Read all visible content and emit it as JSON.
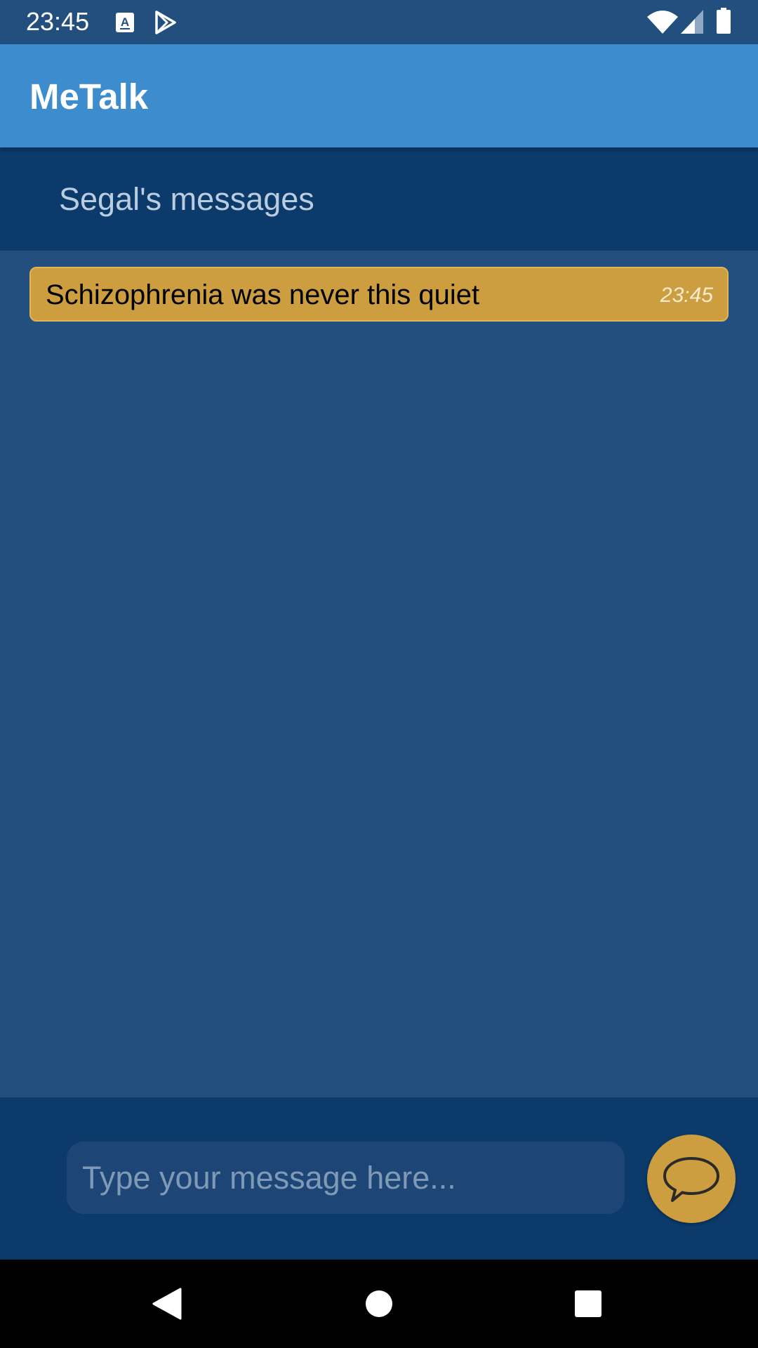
{
  "status_bar": {
    "time": "23:45",
    "icons": [
      "accessibility-a-icon",
      "play-store-icon",
      "wifi-icon",
      "cell-signal-icon",
      "battery-icon"
    ]
  },
  "app_bar": {
    "title": "MeTalk"
  },
  "conversation": {
    "title": "Segal's messages"
  },
  "messages": [
    {
      "text": "Schizophrenia was never this quiet",
      "time": "23:45"
    }
  ],
  "composer": {
    "placeholder": "Type your message here...",
    "value": "",
    "send_icon": "chat-bubble-icon"
  },
  "navigation": {
    "icons": [
      "back-icon",
      "home-icon",
      "recents-icon"
    ]
  },
  "colors": {
    "background": "#234f7e",
    "app_bar": "#3d8ccd",
    "header": "#0c3a6b",
    "accent": "#cc9e40",
    "input": "#1d4676"
  }
}
